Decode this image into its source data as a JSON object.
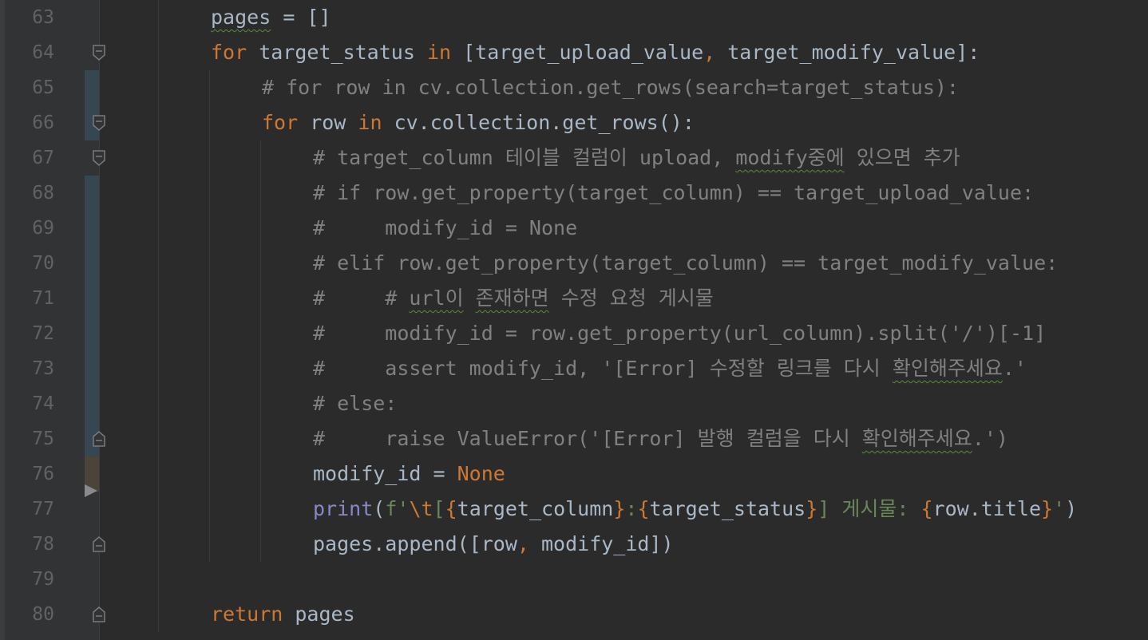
{
  "theme": {
    "background": "#2b2b2b",
    "gutter": "#313335",
    "keyword": "#cc7832",
    "comment": "#808080",
    "string": "#6a8759",
    "builtin": "#8888c6",
    "text": "#a9b7c6",
    "line_number": "#606366",
    "change_modified": "#374752",
    "change_added": "#4a4538"
  },
  "lines": [
    {
      "num": "63",
      "tokens": [
        {
          "t": "pages",
          "c": "pl typo"
        },
        {
          "t": " = []",
          "c": "pl"
        }
      ]
    },
    {
      "num": "64",
      "tokens": [
        {
          "t": "for",
          "c": "kw"
        },
        {
          "t": " target_status ",
          "c": "pl"
        },
        {
          "t": "in",
          "c": "kw"
        },
        {
          "t": " [target_upload_value",
          "c": "pl"
        },
        {
          "t": ",",
          "c": "kw"
        },
        {
          "t": " target_modify_value]:",
          "c": "pl"
        }
      ]
    },
    {
      "num": "65",
      "tokens": [
        {
          "t": "# for row in cv.collection.get_rows(search=target_status):",
          "c": "cm"
        }
      ]
    },
    {
      "num": "66",
      "tokens": [
        {
          "t": "for",
          "c": "kw"
        },
        {
          "t": " row ",
          "c": "pl"
        },
        {
          "t": "in",
          "c": "kw"
        },
        {
          "t": " cv.collection.get_rows():",
          "c": "pl"
        }
      ]
    },
    {
      "num": "67",
      "tokens": [
        {
          "t": "# target_column 테이블 컬럼이 upload, ",
          "c": "cm"
        },
        {
          "t": "modify중에",
          "c": "cm typo"
        },
        {
          "t": " 있으면 추가",
          "c": "cm"
        }
      ]
    },
    {
      "num": "68",
      "tokens": [
        {
          "t": "# if row.get_property(target_column) == target_upload_value:",
          "c": "cm"
        }
      ]
    },
    {
      "num": "69",
      "tokens": [
        {
          "t": "#     modify_id = None",
          "c": "cm"
        }
      ]
    },
    {
      "num": "70",
      "tokens": [
        {
          "t": "# elif row.get_property(target_column) == target_modify_value:",
          "c": "cm"
        }
      ]
    },
    {
      "num": "71",
      "tokens": [
        {
          "t": "#     # ",
          "c": "cm"
        },
        {
          "t": "url이",
          "c": "cm typo"
        },
        {
          "t": " ",
          "c": "cm"
        },
        {
          "t": "존재하면",
          "c": "cm typo"
        },
        {
          "t": " 수정 요청 게시물",
          "c": "cm"
        }
      ]
    },
    {
      "num": "72",
      "tokens": [
        {
          "t": "#     modify_id = row.get_property(url_column).split('/')[-1]",
          "c": "cm"
        }
      ]
    },
    {
      "num": "73",
      "tokens": [
        {
          "t": "#     assert modify_id, '[Error] 수정할 링크를 다시 ",
          "c": "cm"
        },
        {
          "t": "확인해주세요",
          "c": "cm typo"
        },
        {
          "t": ".'",
          "c": "cm"
        }
      ]
    },
    {
      "num": "74",
      "tokens": [
        {
          "t": "# else:",
          "c": "cm"
        }
      ]
    },
    {
      "num": "75",
      "tokens": [
        {
          "t": "#     raise ValueError('[Error] 발행 컬럼을 다시 ",
          "c": "cm"
        },
        {
          "t": "확인해주세요",
          "c": "cm typo"
        },
        {
          "t": ".')",
          "c": "cm"
        }
      ]
    },
    {
      "num": "76",
      "tokens": [
        {
          "t": "modify_id = ",
          "c": "pl"
        },
        {
          "t": "None",
          "c": "kw"
        }
      ]
    },
    {
      "num": "77",
      "tokens": [
        {
          "t": "print",
          "c": "bi"
        },
        {
          "t": "(",
          "c": "pl"
        },
        {
          "t": "f'",
          "c": "str"
        },
        {
          "t": "\\t",
          "c": "esc"
        },
        {
          "t": "[",
          "c": "str"
        },
        {
          "t": "{",
          "c": "fb"
        },
        {
          "t": "target_column",
          "c": "pl"
        },
        {
          "t": "}",
          "c": "fb"
        },
        {
          "t": ":",
          "c": "str"
        },
        {
          "t": "{",
          "c": "fb"
        },
        {
          "t": "target_status",
          "c": "pl"
        },
        {
          "t": "}",
          "c": "fb"
        },
        {
          "t": "] 게시물: ",
          "c": "str"
        },
        {
          "t": "{",
          "c": "fb"
        },
        {
          "t": "row.title",
          "c": "pl"
        },
        {
          "t": "}",
          "c": "fb"
        },
        {
          "t": "'",
          "c": "str"
        },
        {
          "t": ")",
          "c": "pl"
        }
      ]
    },
    {
      "num": "78",
      "tokens": [
        {
          "t": "pages.append([row",
          "c": "pl"
        },
        {
          "t": ",",
          "c": "kw"
        },
        {
          "t": " modify_id])",
          "c": "pl"
        }
      ]
    },
    {
      "num": "79",
      "tokens": []
    },
    {
      "num": "80",
      "tokens": [
        {
          "t": "return",
          "c": "kw"
        },
        {
          "t": " pages",
          "c": "pl"
        }
      ]
    }
  ],
  "fold_markers": [
    {
      "line": "64",
      "shape": "fold-open"
    },
    {
      "line": "66",
      "shape": "fold-open"
    },
    {
      "line": "67",
      "shape": "fold-open"
    },
    {
      "line": "75",
      "shape": "fold-close"
    },
    {
      "line": "78",
      "shape": "fold-close"
    },
    {
      "line": "80",
      "shape": "fold-close"
    }
  ]
}
